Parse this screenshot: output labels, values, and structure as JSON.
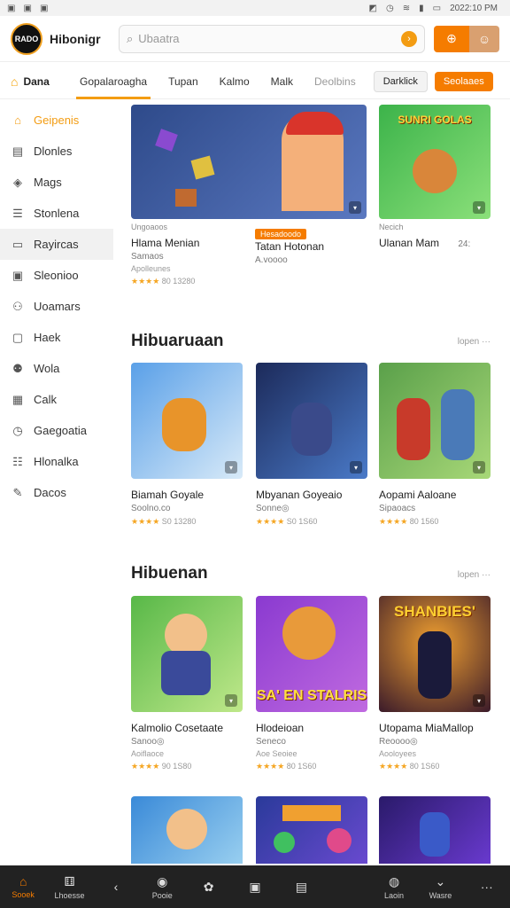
{
  "status_bar": {
    "left_icons": [
      "image-icon",
      "image-icon",
      "image-icon"
    ],
    "right_icons": [
      "notification-icon",
      "alarm-icon",
      "wifi-icon",
      "signal-icon",
      "battery-icon"
    ],
    "time": "2022:10 PM"
  },
  "header": {
    "logo_text": "RADO",
    "app_name": "Hibonigr",
    "search_placeholder": "Ubaatra",
    "search_icon": "search-icon",
    "go_icon": "arrow-right-icon",
    "cart_icon": "basket-icon",
    "avatar_icon": "user-avatar-icon"
  },
  "tabs": {
    "home_label": "Dana",
    "items": [
      {
        "label": "Gopalaroagha",
        "active": true
      },
      {
        "label": "Tupan",
        "active": false
      },
      {
        "label": "Kalmo",
        "active": false
      },
      {
        "label": "Malk",
        "active": false
      },
      {
        "label": "Deolbins",
        "active": false
      }
    ],
    "pill_label": "Darklick",
    "pill_orange_label": "Seolaaes"
  },
  "sidebar": {
    "items": [
      {
        "label": "Geipenis",
        "icon": "home-icon",
        "active": true
      },
      {
        "label": "Dlonles",
        "icon": "document-icon"
      },
      {
        "label": "Mags",
        "icon": "shield-icon"
      },
      {
        "label": "Stonlena",
        "icon": "list-icon"
      },
      {
        "label": "Rayircas",
        "icon": "card-icon",
        "selected": true
      },
      {
        "label": "Sleonioo",
        "icon": "image-icon"
      },
      {
        "label": "Uoamars",
        "icon": "people-icon"
      },
      {
        "label": "Haek",
        "icon": "box-icon"
      },
      {
        "label": "Wola",
        "icon": "group-icon"
      },
      {
        "label": "Calk",
        "icon": "calendar-icon"
      },
      {
        "label": "Gaegoatia",
        "icon": "clock-icon"
      },
      {
        "label": "Hlonalka",
        "icon": "list-icon"
      },
      {
        "label": "Dacos",
        "icon": "edit-icon"
      }
    ]
  },
  "featured": {
    "cards": [
      {
        "title": "Hlama Menian",
        "sub": "Samaos",
        "sub2": "Apolleunes",
        "stars": "★★★★",
        "rating": "80 13280",
        "badge": "Ungoaoos"
      },
      {
        "title": "Tatan Hotonan",
        "sub": "A.voooo",
        "badge": "Hesadoodo"
      },
      {
        "title": "Ulanan Mam",
        "sub": "Necich",
        "extra": "24:"
      }
    ]
  },
  "sections": [
    {
      "title": "Hibuaruaan",
      "more": "lopen ···",
      "cards": [
        {
          "title": "Biamah Goyale",
          "sub": "Soolno.co",
          "stars": "★★★★",
          "rating": "S0 13280"
        },
        {
          "title": "Mbyanan Goyeaio",
          "sub": "Sonne◎",
          "stars": "★★★★",
          "rating": "S0 1S60"
        },
        {
          "title": "Aopami Aaloane",
          "sub": "Sipaoacs",
          "stars": "★★★★",
          "rating": "80 1560"
        }
      ]
    },
    {
      "title": "Hibuenan",
      "more": "lopen ···",
      "cards": [
        {
          "title": "Kalmolio Cosetaate",
          "sub": "Sanoo◎",
          "sub2": "Aoiflaoce",
          "stars": "★★★★",
          "rating": "90 1S80"
        },
        {
          "title": "Hlodeioan",
          "sub": "Seneco",
          "sub2": "Aoe Seoiee",
          "stars": "★★★★",
          "rating": "80 1S60",
          "art": "SA' EN STALRIS"
        },
        {
          "title": "Utopama MiaMallop",
          "sub": "Reoooo◎",
          "sub2": "Aooloyees",
          "stars": "★★★★",
          "rating": "80 1S60",
          "art": "SHANBIES'"
        }
      ]
    }
  ],
  "bottom_nav": [
    {
      "label": "Sooek",
      "icon": "home-icon",
      "active": true
    },
    {
      "label": "Lhoesse",
      "icon": "gamepad-icon"
    },
    {
      "label": "",
      "icon": "back-icon"
    },
    {
      "label": "Pooie",
      "icon": "compass-icon"
    },
    {
      "label": "",
      "icon": "palette-icon"
    },
    {
      "label": "",
      "icon": "square-icon"
    },
    {
      "label": "",
      "icon": "layers-icon"
    },
    {
      "label": "",
      "icon": "spacer"
    },
    {
      "label": "Laoin",
      "icon": "pin-icon"
    },
    {
      "label": "Wasre",
      "icon": "chevron-down-icon"
    },
    {
      "label": "",
      "icon": "more-icon"
    }
  ]
}
